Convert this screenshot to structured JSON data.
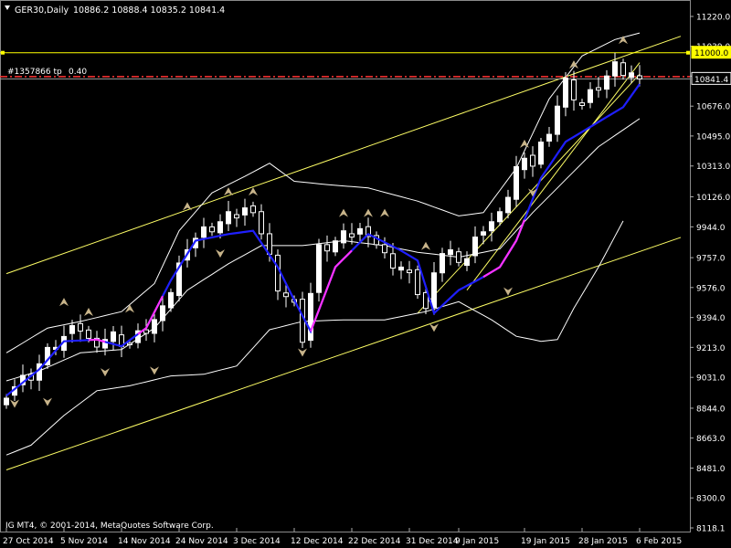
{
  "header": {
    "title": "GER30,Daily",
    "ohlc": "10886.2 10888.4 10835.2 10841.4"
  },
  "order_line": {
    "label": "#1357866 tp",
    "value_text": "0.40"
  },
  "footer": {
    "copyright": "IG MT4, © 2001-2014, MetaQuotes Software Corp."
  },
  "colors": {
    "background": "#000000",
    "bull_candle": "#ffffff",
    "bear_candle": "#000000",
    "moving_average": "#1f1fff",
    "ma_highlight": "#ff33ff",
    "bands": "#ffffff",
    "channel": "#ffff66",
    "level_line": "#ffff00",
    "order_line": "#ff3333",
    "fractal": "#c8b48a"
  },
  "chart_data": {
    "type": "candlestick",
    "symbol": "GER30",
    "timeframe": "Daily",
    "ylim": [
      8118.1,
      11300
    ],
    "y_ticks": [
      11220.0,
      11039.0,
      10858.0,
      10676.0,
      10495.0,
      10313.0,
      10126.0,
      9944.0,
      9757.0,
      9576.0,
      9394.0,
      9213.0,
      9031.0,
      8844.0,
      8663.0,
      8481.0,
      8300.0,
      8118.1
    ],
    "x_labels": [
      "27 Oct 2014",
      "5 Nov 2014",
      "14 Nov 2014",
      "24 Nov 2014",
      "3 Dec 2014",
      "12 Dec 2014",
      "22 Dec 2014",
      "31 Dec 2014",
      "9 Jan 2015",
      "19 Jan 2015",
      "28 Jan 2015",
      "6 Feb 2015"
    ],
    "label_bar_index": [
      0,
      7,
      14,
      21,
      28,
      35,
      42,
      49,
      55,
      63,
      70,
      77
    ],
    "x_step": 4.5,
    "current_price": 10841.4,
    "price_labels": [
      {
        "value": 11000.0,
        "text": "11000.0",
        "style": "yellow-box"
      },
      {
        "value": 10841.4,
        "text": "10841.4",
        "style": "white-box"
      }
    ],
    "horizontal_levels": [
      {
        "value": 11000.0,
        "kind": "level"
      },
      {
        "value": 10855.0,
        "kind": "take-profit"
      },
      {
        "value": 10841.4,
        "kind": "price"
      }
    ],
    "key_closes": [
      {
        "bar": 0,
        "close": 8950
      },
      {
        "bar": 3,
        "close": 9050
      },
      {
        "bar": 6,
        "close": 9240
      },
      {
        "bar": 9,
        "close": 9330
      },
      {
        "bar": 10,
        "close": 9250
      },
      {
        "bar": 13,
        "close": 9280
      },
      {
        "bar": 15,
        "close": 9230
      },
      {
        "bar": 19,
        "close": 9420
      },
      {
        "bar": 22,
        "close": 9850
      },
      {
        "bar": 25,
        "close": 9950
      },
      {
        "bar": 29,
        "close": 10050
      },
      {
        "bar": 31,
        "close": 9920
      },
      {
        "bar": 33,
        "close": 9600
      },
      {
        "bar": 35,
        "close": 9460
      },
      {
        "bar": 36,
        "close": 9280
      },
      {
        "bar": 38,
        "close": 9800
      },
      {
        "bar": 42,
        "close": 9900
      },
      {
        "bar": 44,
        "close": 9930
      },
      {
        "bar": 46,
        "close": 9760
      },
      {
        "bar": 48,
        "close": 9700
      },
      {
        "bar": 50,
        "close": 9560
      },
      {
        "bar": 51,
        "close": 9440
      },
      {
        "bar": 53,
        "close": 9800
      },
      {
        "bar": 56,
        "close": 9760
      },
      {
        "bar": 58,
        "close": 9950
      },
      {
        "bar": 60,
        "close": 10000
      },
      {
        "bar": 62,
        "close": 10300
      },
      {
        "bar": 64,
        "close": 10330
      },
      {
        "bar": 66,
        "close": 10550
      },
      {
        "bar": 68,
        "close": 10820
      },
      {
        "bar": 70,
        "close": 10680
      },
      {
        "bar": 72,
        "close": 10800
      },
      {
        "bar": 74,
        "close": 10900
      },
      {
        "bar": 76,
        "close": 10860
      },
      {
        "bar": 77,
        "close": 10841.4
      }
    ],
    "ma_key": [
      {
        "bar": 0,
        "v": 8920
      },
      {
        "bar": 4,
        "v": 9080
      },
      {
        "bar": 7,
        "v": 9250
      },
      {
        "bar": 11,
        "v": 9260
      },
      {
        "bar": 14,
        "v": 9220
      },
      {
        "bar": 17,
        "v": 9330
      },
      {
        "bar": 20,
        "v": 9620
      },
      {
        "bar": 23,
        "v": 9860
      },
      {
        "bar": 27,
        "v": 9900
      },
      {
        "bar": 30,
        "v": 9920
      },
      {
        "bar": 33,
        "v": 9700
      },
      {
        "bar": 35,
        "v": 9500
      },
      {
        "bar": 37,
        "v": 9310
      },
      {
        "bar": 40,
        "v": 9700
      },
      {
        "bar": 44,
        "v": 9900
      },
      {
        "bar": 46,
        "v": 9850
      },
      {
        "bar": 48,
        "v": 9800
      },
      {
        "bar": 50,
        "v": 9740
      },
      {
        "bar": 52,
        "v": 9420
      },
      {
        "bar": 55,
        "v": 9560
      },
      {
        "bar": 58,
        "v": 9640
      },
      {
        "bar": 60,
        "v": 9700
      },
      {
        "bar": 62,
        "v": 9860
      },
      {
        "bar": 65,
        "v": 10240
      },
      {
        "bar": 68,
        "v": 10460
      },
      {
        "bar": 72,
        "v": 10580
      },
      {
        "bar": 75,
        "v": 10670
      },
      {
        "bar": 77,
        "v": 10810
      }
    ],
    "ma_highlight_bars": [
      [
        10,
        12
      ],
      [
        16,
        19
      ],
      [
        37,
        42
      ],
      [
        58,
        63
      ]
    ],
    "band_upper_key": [
      {
        "bar": 0,
        "v": 9180
      },
      {
        "bar": 5,
        "v": 9330
      },
      {
        "bar": 9,
        "v": 9370
      },
      {
        "bar": 14,
        "v": 9430
      },
      {
        "bar": 18,
        "v": 9600
      },
      {
        "bar": 21,
        "v": 9920
      },
      {
        "bar": 25,
        "v": 10150
      },
      {
        "bar": 29,
        "v": 10250
      },
      {
        "bar": 32,
        "v": 10330
      },
      {
        "bar": 35,
        "v": 10220
      },
      {
        "bar": 39,
        "v": 10200
      },
      {
        "bar": 44,
        "v": 10180
      },
      {
        "bar": 50,
        "v": 10100
      },
      {
        "bar": 55,
        "v": 10010
      },
      {
        "bar": 58,
        "v": 10030
      },
      {
        "bar": 62,
        "v": 10300
      },
      {
        "bar": 66,
        "v": 10720
      },
      {
        "bar": 70,
        "v": 10980
      },
      {
        "bar": 74,
        "v": 11080
      },
      {
        "bar": 77,
        "v": 11120
      }
    ],
    "band_middle_key": [
      {
        "bar": 0,
        "v": 9010
      },
      {
        "bar": 4,
        "v": 9070
      },
      {
        "bar": 9,
        "v": 9180
      },
      {
        "bar": 14,
        "v": 9200
      },
      {
        "bar": 18,
        "v": 9330
      },
      {
        "bar": 22,
        "v": 9560
      },
      {
        "bar": 27,
        "v": 9720
      },
      {
        "bar": 31,
        "v": 9830
      },
      {
        "bar": 36,
        "v": 9830
      },
      {
        "bar": 41,
        "v": 9860
      },
      {
        "bar": 46,
        "v": 9830
      },
      {
        "bar": 50,
        "v": 9790
      },
      {
        "bar": 55,
        "v": 9760
      },
      {
        "bar": 60,
        "v": 9810
      },
      {
        "bar": 64,
        "v": 10030
      },
      {
        "bar": 68,
        "v": 10230
      },
      {
        "bar": 72,
        "v": 10430
      },
      {
        "bar": 77,
        "v": 10600
      }
    ],
    "band_lower_key": [
      {
        "bar": 0,
        "v": 8560
      },
      {
        "bar": 3,
        "v": 8620
      },
      {
        "bar": 7,
        "v": 8800
      },
      {
        "bar": 11,
        "v": 8950
      },
      {
        "bar": 15,
        "v": 8980
      },
      {
        "bar": 20,
        "v": 9040
      },
      {
        "bar": 24,
        "v": 9050
      },
      {
        "bar": 28,
        "v": 9100
      },
      {
        "bar": 32,
        "v": 9320
      },
      {
        "bar": 36,
        "v": 9370
      },
      {
        "bar": 41,
        "v": 9380
      },
      {
        "bar": 46,
        "v": 9380
      },
      {
        "bar": 51,
        "v": 9430
      },
      {
        "bar": 55,
        "v": 9490
      },
      {
        "bar": 59,
        "v": 9380
      },
      {
        "bar": 62,
        "v": 9280
      },
      {
        "bar": 65,
        "v": 9250
      },
      {
        "bar": 67,
        "v": 9260
      },
      {
        "bar": 69,
        "v": 9450
      },
      {
        "bar": 72,
        "v": 9700
      },
      {
        "bar": 75,
        "v": 9980
      }
    ],
    "channel_lines": [
      {
        "from": {
          "bar": 0,
          "v": 9660
        },
        "to": {
          "bar": 82,
          "v": 11100
        }
      },
      {
        "from": {
          "bar": 0,
          "v": 8470
        },
        "to": {
          "bar": 82,
          "v": 9880
        }
      },
      {
        "from": {
          "bar": 50,
          "v": 9420
        },
        "to": {
          "bar": 77,
          "v": 10870
        }
      },
      {
        "from": {
          "bar": 56,
          "v": 9560
        },
        "to": {
          "bar": 77,
          "v": 10940
        }
      }
    ],
    "fractals_up": [
      {
        "bar": 7,
        "v": 9480
      },
      {
        "bar": 10,
        "v": 9420
      },
      {
        "bar": 15,
        "v": 9440
      },
      {
        "bar": 22,
        "v": 10060
      },
      {
        "bar": 27,
        "v": 10150
      },
      {
        "bar": 30,
        "v": 10150
      },
      {
        "bar": 41,
        "v": 10020
      },
      {
        "bar": 44,
        "v": 10020
      },
      {
        "bar": 46,
        "v": 10020
      },
      {
        "bar": 51,
        "v": 9820
      },
      {
        "bar": 63,
        "v": 10440
      },
      {
        "bar": 69,
        "v": 10920
      },
      {
        "bar": 75,
        "v": 11070
      }
    ],
    "fractals_down": [
      {
        "bar": 1,
        "v": 8880
      },
      {
        "bar": 5,
        "v": 8890
      },
      {
        "bar": 12,
        "v": 9070
      },
      {
        "bar": 18,
        "v": 9080
      },
      {
        "bar": 26,
        "v": 9790
      },
      {
        "bar": 36,
        "v": 9190
      },
      {
        "bar": 52,
        "v": 9340
      },
      {
        "bar": 61,
        "v": 9560
      },
      {
        "bar": 64,
        "v": 10160
      }
    ]
  }
}
